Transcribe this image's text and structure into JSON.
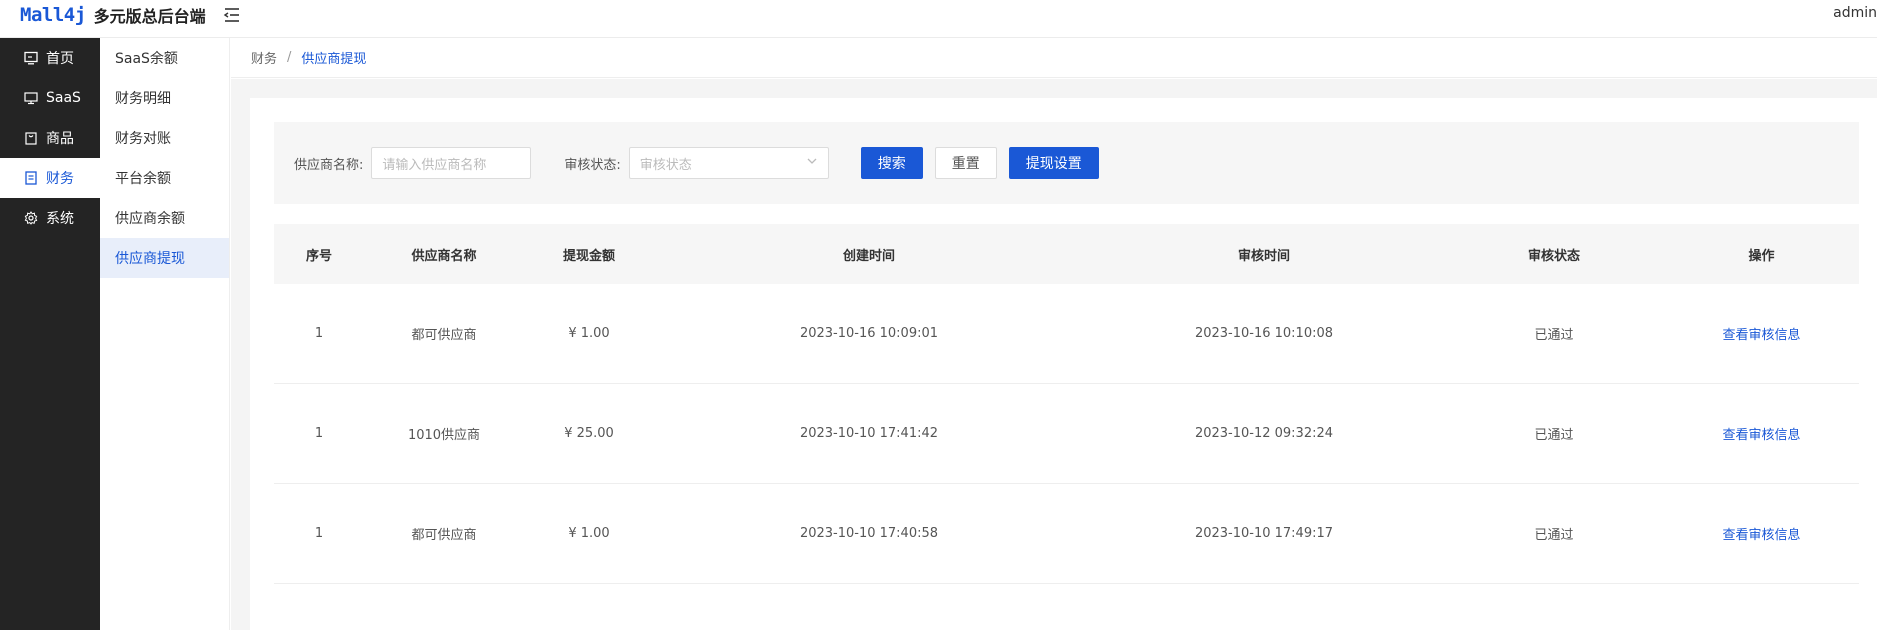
{
  "header": {
    "logo": "Mall4j",
    "system_title": "多元版总后台端",
    "user": "admin"
  },
  "sidebar": {
    "items": [
      {
        "label": "首页",
        "icon": "monitor-icon"
      },
      {
        "label": "SaaS",
        "icon": "screen-icon"
      },
      {
        "label": "商品",
        "icon": "bag-icon"
      },
      {
        "label": "财务",
        "icon": "document-icon",
        "active": true
      },
      {
        "label": "系统",
        "icon": "gear-icon"
      }
    ]
  },
  "submenu": {
    "items": [
      {
        "label": "SaaS余额"
      },
      {
        "label": "财务明细"
      },
      {
        "label": "财务对账"
      },
      {
        "label": "平台余额"
      },
      {
        "label": "供应商余额"
      },
      {
        "label": "供应商提现",
        "active": true
      }
    ]
  },
  "breadcrumb": {
    "parent": "财务",
    "separator": "/",
    "current": "供应商提现"
  },
  "filter": {
    "supplier_label": "供应商名称:",
    "supplier_placeholder": "请输入供应商名称",
    "status_label": "审核状态:",
    "status_placeholder": "审核状态",
    "search_button": "搜索",
    "reset_button": "重置",
    "settings_button": "提现设置"
  },
  "table": {
    "columns": [
      "序号",
      "供应商名称",
      "提现金额",
      "创建时间",
      "审核时间",
      "审核状态",
      "操作"
    ],
    "rows": [
      {
        "index": "1",
        "supplier": "都可供应商",
        "amount": "¥ 1.00",
        "created": "2023-10-16 10:09:01",
        "reviewed": "2023-10-16 10:10:08",
        "status": "已通过",
        "action": "查看审核信息"
      },
      {
        "index": "1",
        "supplier": "1010供应商",
        "amount": "¥ 25.00",
        "created": "2023-10-10 17:41:42",
        "reviewed": "2023-10-12 09:32:24",
        "status": "已通过",
        "action": "查看审核信息"
      },
      {
        "index": "1",
        "supplier": "都可供应商",
        "amount": "¥ 1.00",
        "created": "2023-10-10 17:40:58",
        "reviewed": "2023-10-10 17:49:17",
        "status": "已通过",
        "action": "查看审核信息"
      }
    ]
  },
  "colors": {
    "primary": "#1a58d6",
    "sidebar_bg": "#242424",
    "submenu_active_bg": "#e8eefa"
  }
}
